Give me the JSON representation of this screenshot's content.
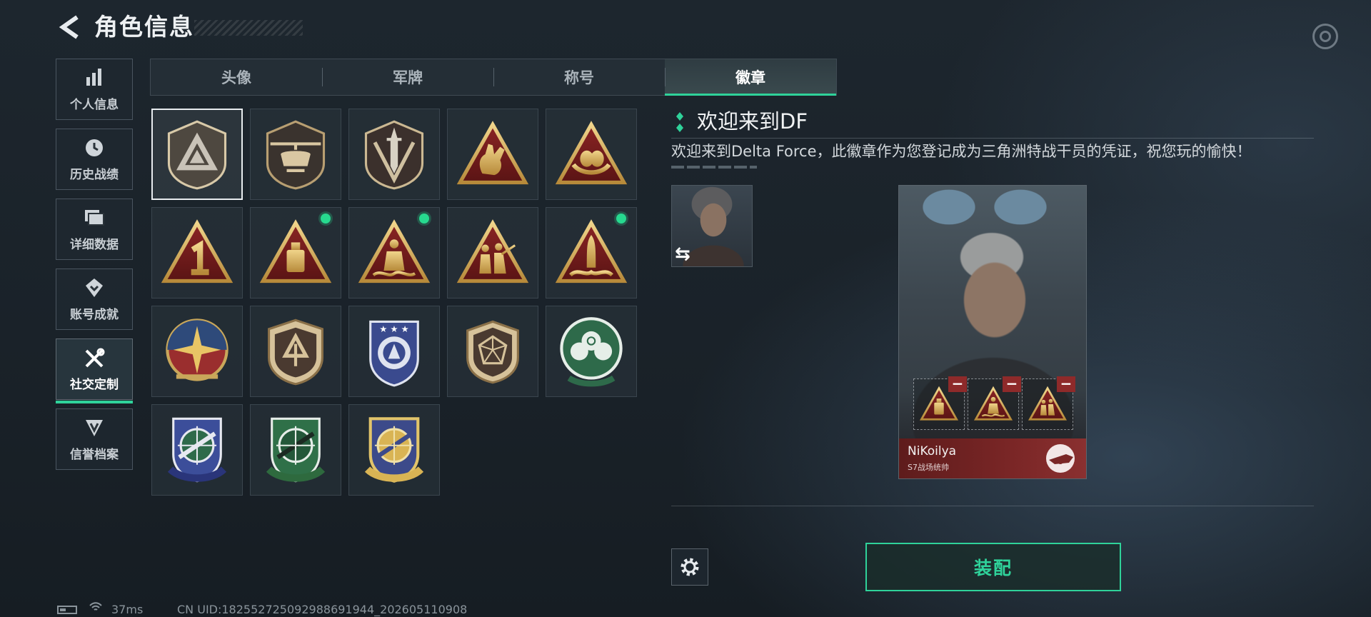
{
  "header": {
    "title": "角色信息"
  },
  "sidebar": {
    "items": [
      {
        "label": "个人信息",
        "icon": "bar-chart-icon",
        "active": false
      },
      {
        "label": "历史战绩",
        "icon": "clock-icon",
        "active": false
      },
      {
        "label": "详细数据",
        "icon": "folder-icon",
        "active": false
      },
      {
        "label": "账号成就",
        "icon": "achievement-icon",
        "active": false
      },
      {
        "label": "社交定制",
        "icon": "tools-icon",
        "active": true
      },
      {
        "label": "信誉档案",
        "icon": "reputation-icon",
        "active": false
      }
    ]
  },
  "tabs": [
    {
      "label": "头像",
      "active": false
    },
    {
      "label": "军牌",
      "active": false
    },
    {
      "label": "称号",
      "active": false
    },
    {
      "label": "徽章",
      "active": true
    }
  ],
  "badges": [
    {
      "name": "delta-triangle-badge",
      "selected": true,
      "new": false
    },
    {
      "name": "helicopter-badge",
      "selected": false,
      "new": false
    },
    {
      "name": "dagger-badge",
      "selected": false,
      "new": false
    },
    {
      "name": "hand-sign-badge",
      "selected": false,
      "new": false
    },
    {
      "name": "egg-nest-badge",
      "selected": false,
      "new": false
    },
    {
      "name": "number-one-badge",
      "selected": false,
      "new": false
    },
    {
      "name": "bottle-badge",
      "selected": false,
      "new": true
    },
    {
      "name": "statue-badge",
      "selected": false,
      "new": true
    },
    {
      "name": "soldiers-badge",
      "selected": false,
      "new": false
    },
    {
      "name": "rocket-badge",
      "selected": false,
      "new": true
    },
    {
      "name": "star-compass-badge",
      "selected": false,
      "new": false
    },
    {
      "name": "brown-shield-badge",
      "selected": false,
      "new": false
    },
    {
      "name": "blue-shield-badge",
      "selected": false,
      "new": false
    },
    {
      "name": "d20-shield-badge",
      "selected": false,
      "new": false
    },
    {
      "name": "green-skull-badge",
      "selected": false,
      "new": false
    },
    {
      "name": "blue-rifle-badge",
      "selected": false,
      "new": false
    },
    {
      "name": "green-rifle-badge",
      "selected": false,
      "new": false
    },
    {
      "name": "gold-rifle-badge",
      "selected": false,
      "new": false
    }
  ],
  "detail": {
    "title": "欢迎来到DF",
    "description": "欢迎来到Delta Force，此徽章作为您登记成为三角洲特战干员的凭证，祝您玩的愉快！"
  },
  "card": {
    "player_name": "NiKoilya",
    "rank": "S7战场统帅",
    "equipped_slots": [
      "bottle-badge",
      "statue-badge",
      "soldiers-badge"
    ]
  },
  "actions": {
    "equip_label": "装配"
  },
  "status": {
    "ping": "37ms",
    "uid": "CN UID:18255272509298869194​4_202605110908"
  },
  "colors": {
    "accent": "#2fd29a",
    "new_dot": "#27d98f",
    "card_footer": "#7a2626"
  }
}
